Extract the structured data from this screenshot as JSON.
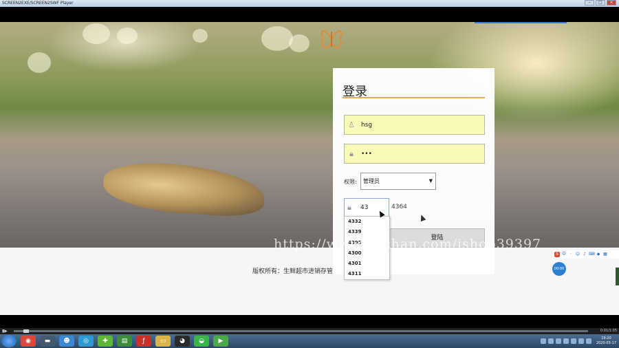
{
  "window": {
    "title": "SCREEN2EXE/SCREEN2SWF Player",
    "minimize": "–",
    "maximize": "□",
    "close": "×"
  },
  "login": {
    "title": "登录",
    "username_value": "hsg",
    "password_value": "•••",
    "role_label": "权限:",
    "role_selected": "管理员",
    "captcha_value": "43",
    "captcha_code": "4364",
    "login_button": "登陆"
  },
  "autocomplete": {
    "options": [
      "4332",
      "4339",
      "4395",
      "4300",
      "4301",
      "4311"
    ]
  },
  "footer": {
    "copyright": "版权所有：生鲜超市进销存管"
  },
  "watermark": "https://www.huzhan.com/ishop39397",
  "overlay": {
    "bubble_label": "00:00"
  },
  "player": {
    "time": "0:01/1:05",
    "play_button": "▮▶"
  },
  "taskbar": {
    "clock_time": "19:20",
    "clock_date": "2020-03-17",
    "icons": [
      "chrome-icon",
      "media-icon",
      "people-icon",
      "browser-icon",
      "app-icon",
      "notepad-icon",
      "flash-icon",
      "folder-icon",
      "qq-icon",
      "wechat-icon",
      "player-icon"
    ]
  },
  "colors": {
    "field_bg": "#fafab8",
    "title_underline": "#e8a85a",
    "taskbar": "#2c4765"
  }
}
